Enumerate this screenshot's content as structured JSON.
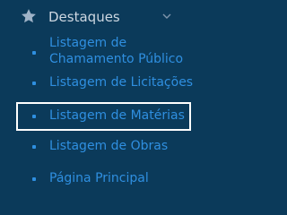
{
  "sidebar": {
    "group": {
      "icon": "star-icon",
      "label": "Destaques",
      "expand_icon": "chevron-down-icon"
    },
    "items": [
      {
        "label_line1": "Listagem de",
        "label_line2": "Chamamento Público"
      },
      {
        "label": "Listagem de Licitações"
      },
      {
        "label": "Listagem de Matérias",
        "active": true
      },
      {
        "label": "Listagem de Obras"
      },
      {
        "label": "Página Principal"
      }
    ]
  },
  "colors": {
    "background": "#0b3a5a",
    "group_text": "#cdd7e1",
    "item_text": "#2f8fe0",
    "highlight_border": "#ffffff"
  }
}
